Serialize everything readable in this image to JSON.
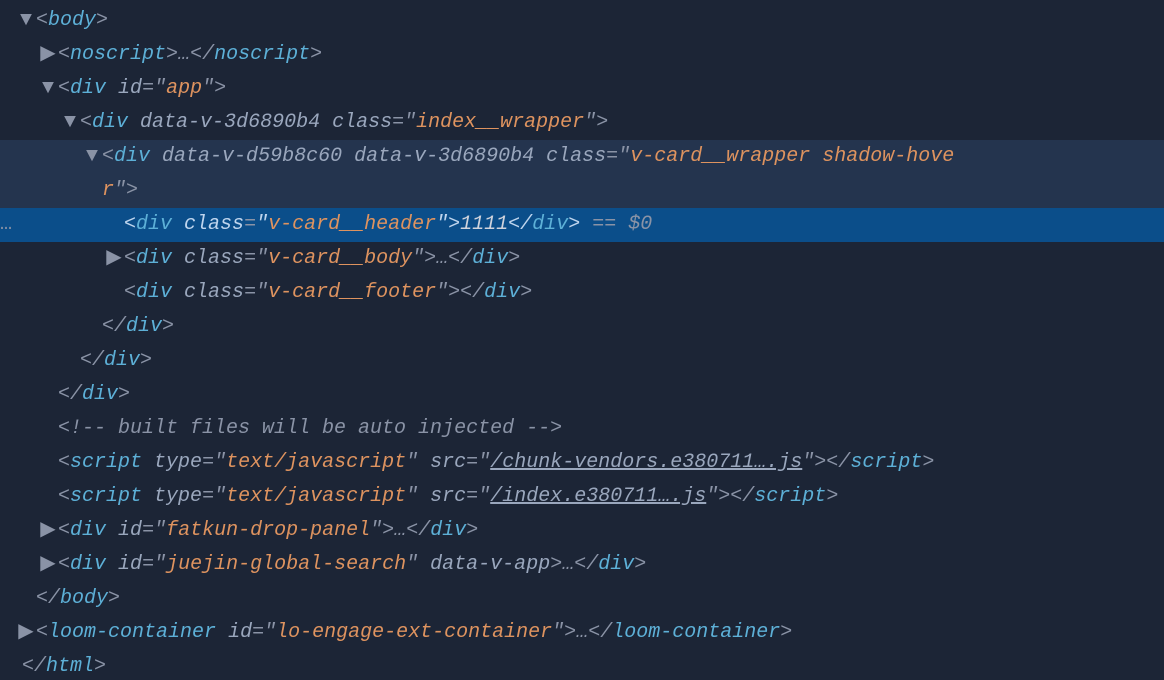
{
  "rows": [
    {
      "indent": 0,
      "caret": "▼",
      "sel": false,
      "hl": false,
      "segments": [
        {
          "t": "ang",
          "v": "<"
        },
        {
          "t": "tag",
          "v": "body"
        },
        {
          "t": "ang",
          "v": ">"
        }
      ]
    },
    {
      "indent": 1,
      "caret": "▶",
      "sel": false,
      "hl": false,
      "segments": [
        {
          "t": "ang",
          "v": "<"
        },
        {
          "t": "tag",
          "v": "noscript"
        },
        {
          "t": "ang",
          "v": ">"
        },
        {
          "t": "ell",
          "v": "…"
        },
        {
          "t": "ang",
          "v": "</"
        },
        {
          "t": "tag",
          "v": "noscript"
        },
        {
          "t": "ang",
          "v": ">"
        }
      ]
    },
    {
      "indent": 1,
      "caret": "▼",
      "sel": false,
      "hl": false,
      "segments": [
        {
          "t": "ang",
          "v": "<"
        },
        {
          "t": "tag",
          "v": "div"
        },
        {
          "t": "txt",
          "v": " "
        },
        {
          "t": "attrname",
          "v": "id"
        },
        {
          "t": "eq",
          "v": "="
        },
        {
          "t": "ang",
          "v": "\""
        },
        {
          "t": "str",
          "v": "app"
        },
        {
          "t": "ang",
          "v": "\""
        },
        {
          "t": "ang",
          "v": ">"
        }
      ]
    },
    {
      "indent": 2,
      "caret": "▼",
      "sel": false,
      "hl": false,
      "segments": [
        {
          "t": "ang",
          "v": "<"
        },
        {
          "t": "tag",
          "v": "div"
        },
        {
          "t": "txt",
          "v": " "
        },
        {
          "t": "attrname",
          "v": "data-v-3d6890b4"
        },
        {
          "t": "txt",
          "v": " "
        },
        {
          "t": "attrname",
          "v": "class"
        },
        {
          "t": "eq",
          "v": "="
        },
        {
          "t": "ang",
          "v": "\""
        },
        {
          "t": "str",
          "v": "index__wrapper"
        },
        {
          "t": "ang",
          "v": "\""
        },
        {
          "t": "ang",
          "v": ">"
        }
      ]
    },
    {
      "indent": 3,
      "caret": "▼",
      "sel": false,
      "hl": true,
      "segments": [
        {
          "t": "ang",
          "v": "<"
        },
        {
          "t": "tag",
          "v": "div"
        },
        {
          "t": "txt",
          "v": " "
        },
        {
          "t": "attrname",
          "v": "data-v-d59b8c60"
        },
        {
          "t": "txt",
          "v": " "
        },
        {
          "t": "attrname",
          "v": "data-v-3d6890b4"
        },
        {
          "t": "txt",
          "v": " "
        },
        {
          "t": "attrname",
          "v": "class"
        },
        {
          "t": "eq",
          "v": "="
        },
        {
          "t": "ang",
          "v": "\""
        },
        {
          "t": "str",
          "v": "v-card__wrapper shadow-hove"
        }
      ]
    },
    {
      "indent": 3,
      "caret": "",
      "sel": false,
      "hl": true,
      "segments": [
        {
          "t": "str",
          "v": "r"
        },
        {
          "t": "ang",
          "v": "\""
        },
        {
          "t": "ang",
          "v": ">"
        }
      ]
    },
    {
      "indent": 4,
      "caret": "",
      "sel": true,
      "hl": false,
      "gutter": "…",
      "segments": [
        {
          "t": "ang",
          "v": "<"
        },
        {
          "t": "tag",
          "v": "div"
        },
        {
          "t": "txt",
          "v": " "
        },
        {
          "t": "attrname",
          "v": "class"
        },
        {
          "t": "eq",
          "v": "="
        },
        {
          "t": "ang",
          "v": "\""
        },
        {
          "t": "str",
          "v": "v-card__header"
        },
        {
          "t": "ang",
          "v": "\""
        },
        {
          "t": "ang",
          "v": ">"
        },
        {
          "t": "txt",
          "v": "1111"
        },
        {
          "t": "ang",
          "v": "</"
        },
        {
          "t": "tag",
          "v": "div"
        },
        {
          "t": "ang",
          "v": ">"
        },
        {
          "t": "d0r",
          "v": " == $0"
        }
      ]
    },
    {
      "indent": 4,
      "caret": "▶",
      "sel": false,
      "hl": false,
      "segments": [
        {
          "t": "ang",
          "v": "<"
        },
        {
          "t": "tag",
          "v": "div"
        },
        {
          "t": "txt",
          "v": " "
        },
        {
          "t": "attrname",
          "v": "class"
        },
        {
          "t": "eq",
          "v": "="
        },
        {
          "t": "ang",
          "v": "\""
        },
        {
          "t": "str",
          "v": "v-card__body"
        },
        {
          "t": "ang",
          "v": "\""
        },
        {
          "t": "ang",
          "v": ">"
        },
        {
          "t": "ell",
          "v": "…"
        },
        {
          "t": "ang",
          "v": "</"
        },
        {
          "t": "tag",
          "v": "div"
        },
        {
          "t": "ang",
          "v": ">"
        }
      ]
    },
    {
      "indent": 4,
      "caret": "",
      "sel": false,
      "hl": false,
      "segments": [
        {
          "t": "ang",
          "v": "<"
        },
        {
          "t": "tag",
          "v": "div"
        },
        {
          "t": "txt",
          "v": " "
        },
        {
          "t": "attrname",
          "v": "class"
        },
        {
          "t": "eq",
          "v": "="
        },
        {
          "t": "ang",
          "v": "\""
        },
        {
          "t": "str",
          "v": "v-card__footer"
        },
        {
          "t": "ang",
          "v": "\""
        },
        {
          "t": "ang",
          "v": ">"
        },
        {
          "t": "ang",
          "v": "</"
        },
        {
          "t": "tag",
          "v": "div"
        },
        {
          "t": "ang",
          "v": ">"
        }
      ]
    },
    {
      "indent": 3,
      "caret": "",
      "sel": false,
      "hl": false,
      "segments": [
        {
          "t": "ang",
          "v": "</"
        },
        {
          "t": "tag",
          "v": "div"
        },
        {
          "t": "ang",
          "v": ">"
        }
      ]
    },
    {
      "indent": 2,
      "caret": "",
      "sel": false,
      "hl": false,
      "segments": [
        {
          "t": "ang",
          "v": "</"
        },
        {
          "t": "tag",
          "v": "div"
        },
        {
          "t": "ang",
          "v": ">"
        }
      ]
    },
    {
      "indent": 1,
      "caret": "",
      "sel": false,
      "hl": false,
      "segments": [
        {
          "t": "ang",
          "v": "</"
        },
        {
          "t": "tag",
          "v": "div"
        },
        {
          "t": "ang",
          "v": ">"
        }
      ]
    },
    {
      "indent": 1,
      "caret": "",
      "sel": false,
      "hl": false,
      "segments": [
        {
          "t": "cmt",
          "v": "<!-- built files will be auto injected -->"
        }
      ]
    },
    {
      "indent": 1,
      "caret": "",
      "sel": false,
      "hl": false,
      "segments": [
        {
          "t": "ang",
          "v": "<"
        },
        {
          "t": "tag",
          "v": "script"
        },
        {
          "t": "txt",
          "v": " "
        },
        {
          "t": "attrname",
          "v": "type"
        },
        {
          "t": "eq",
          "v": "="
        },
        {
          "t": "ang",
          "v": "\""
        },
        {
          "t": "str",
          "v": "text/javascript"
        },
        {
          "t": "ang",
          "v": "\""
        },
        {
          "t": "txt",
          "v": " "
        },
        {
          "t": "attrname",
          "v": "src"
        },
        {
          "t": "eq",
          "v": "="
        },
        {
          "t": "ang",
          "v": "\""
        },
        {
          "t": "link",
          "v": "/chunk-vendors.e380711….js"
        },
        {
          "t": "ang",
          "v": "\""
        },
        {
          "t": "ang",
          "v": ">"
        },
        {
          "t": "ang",
          "v": "</"
        },
        {
          "t": "tag",
          "v": "script"
        },
        {
          "t": "ang",
          "v": ">"
        }
      ]
    },
    {
      "indent": 1,
      "caret": "",
      "sel": false,
      "hl": false,
      "segments": [
        {
          "t": "ang",
          "v": "<"
        },
        {
          "t": "tag",
          "v": "script"
        },
        {
          "t": "txt",
          "v": " "
        },
        {
          "t": "attrname",
          "v": "type"
        },
        {
          "t": "eq",
          "v": "="
        },
        {
          "t": "ang",
          "v": "\""
        },
        {
          "t": "str",
          "v": "text/javascript"
        },
        {
          "t": "ang",
          "v": "\""
        },
        {
          "t": "txt",
          "v": " "
        },
        {
          "t": "attrname",
          "v": "src"
        },
        {
          "t": "eq",
          "v": "="
        },
        {
          "t": "ang",
          "v": "\""
        },
        {
          "t": "link",
          "v": "/index.e380711….js"
        },
        {
          "t": "ang",
          "v": "\""
        },
        {
          "t": "ang",
          "v": ">"
        },
        {
          "t": "ang",
          "v": "</"
        },
        {
          "t": "tag",
          "v": "script"
        },
        {
          "t": "ang",
          "v": ">"
        }
      ]
    },
    {
      "indent": 1,
      "caret": "▶",
      "sel": false,
      "hl": false,
      "segments": [
        {
          "t": "ang",
          "v": "<"
        },
        {
          "t": "tag",
          "v": "div"
        },
        {
          "t": "txt",
          "v": " "
        },
        {
          "t": "attrname",
          "v": "id"
        },
        {
          "t": "eq",
          "v": "="
        },
        {
          "t": "ang",
          "v": "\""
        },
        {
          "t": "str",
          "v": "fatkun-drop-panel"
        },
        {
          "t": "ang",
          "v": "\""
        },
        {
          "t": "ang",
          "v": ">"
        },
        {
          "t": "ell",
          "v": "…"
        },
        {
          "t": "ang",
          "v": "</"
        },
        {
          "t": "tag",
          "v": "div"
        },
        {
          "t": "ang",
          "v": ">"
        }
      ]
    },
    {
      "indent": 1,
      "caret": "▶",
      "sel": false,
      "hl": false,
      "segments": [
        {
          "t": "ang",
          "v": "<"
        },
        {
          "t": "tag",
          "v": "div"
        },
        {
          "t": "txt",
          "v": " "
        },
        {
          "t": "attrname",
          "v": "id"
        },
        {
          "t": "eq",
          "v": "="
        },
        {
          "t": "ang",
          "v": "\""
        },
        {
          "t": "str",
          "v": "juejin-global-search"
        },
        {
          "t": "ang",
          "v": "\""
        },
        {
          "t": "txt",
          "v": " "
        },
        {
          "t": "attrname",
          "v": "data-v-app"
        },
        {
          "t": "ang",
          "v": ">"
        },
        {
          "t": "ell",
          "v": "…"
        },
        {
          "t": "ang",
          "v": "</"
        },
        {
          "t": "tag",
          "v": "div"
        },
        {
          "t": "ang",
          "v": ">"
        }
      ]
    },
    {
      "indent": 0,
      "caret": "",
      "sel": false,
      "hl": false,
      "segments": [
        {
          "t": "ang",
          "v": "</"
        },
        {
          "t": "tag",
          "v": "body"
        },
        {
          "t": "ang",
          "v": ">"
        }
      ]
    },
    {
      "indent": 0,
      "caret": "▶",
      "sel": false,
      "hl": false,
      "segments": [
        {
          "t": "ang",
          "v": "<"
        },
        {
          "t": "tag",
          "v": "loom-container"
        },
        {
          "t": "txt",
          "v": " "
        },
        {
          "t": "attrname",
          "v": "id"
        },
        {
          "t": "eq",
          "v": "="
        },
        {
          "t": "ang",
          "v": "\""
        },
        {
          "t": "str",
          "v": "lo-engage-ext-container"
        },
        {
          "t": "ang",
          "v": "\""
        },
        {
          "t": "ang",
          "v": ">"
        },
        {
          "t": "ell",
          "v": "…"
        },
        {
          "t": "ang",
          "v": "</"
        },
        {
          "t": "tag",
          "v": "loom-container"
        },
        {
          "t": "ang",
          "v": ">"
        }
      ]
    },
    {
      "indent": 0,
      "caret": "",
      "sel": false,
      "hl": false,
      "noindent": true,
      "segments": [
        {
          "t": "ang",
          "v": "</"
        },
        {
          "t": "tag",
          "v": "html"
        },
        {
          "t": "ang",
          "v": ">"
        }
      ]
    }
  ]
}
